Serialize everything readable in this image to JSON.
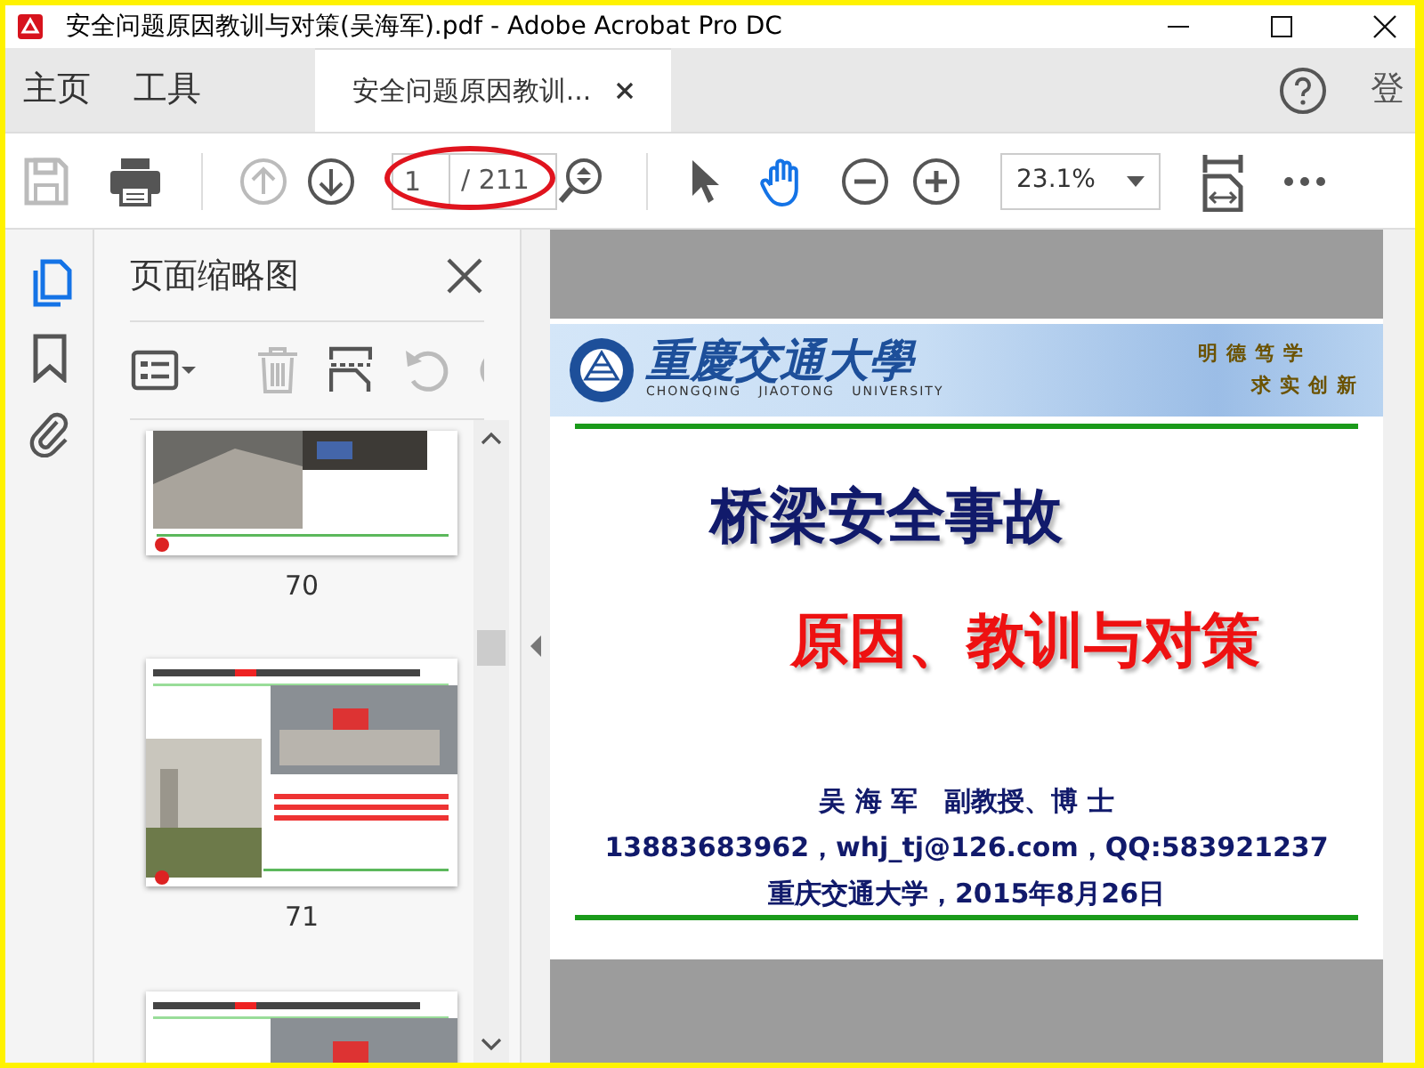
{
  "window": {
    "title": "安全问题原因教训与对策(吴海军).pdf - Adobe Acrobat Pro DC"
  },
  "nav_tabs": [
    {
      "label": "主页",
      "selected": false
    },
    {
      "label": "工具",
      "selected": false
    }
  ],
  "document_tab": {
    "label": "安全问题原因教训..."
  },
  "sign_in": "登",
  "toolbar": {
    "page_number": "1",
    "page_total": "/ 211",
    "zoom": "23.1%"
  },
  "annotation": {
    "kind": "ellipse",
    "color": "#e0141e"
  },
  "sidebar": {
    "title": "页面缩略图",
    "thumbnails": [
      {
        "label": "70",
        "kind": "end"
      },
      {
        "label": "71",
        "kind": "full"
      },
      {
        "kind": "full"
      }
    ]
  },
  "slide": {
    "banner": {
      "name": "重慶交通大學",
      "english": "CHONGQING   JIAOTONG   UNIVERSITY",
      "motto": [
        "明德笃学",
        "求实创新"
      ]
    },
    "titles": [
      {
        "text": "桥梁安全事故",
        "kind": "main"
      },
      {
        "text": "原因、教训与对策",
        "kind": "sub"
      }
    ],
    "info": [
      "吴 海 军　副教授、博 士",
      "13883683962，whj_tj@126.com，QQ:583921237",
      "重庆交通大学，2015年8月26日"
    ]
  }
}
